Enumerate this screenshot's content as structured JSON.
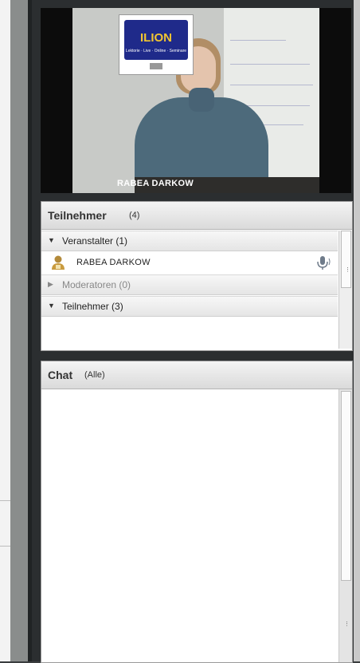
{
  "video": {
    "presenter_name": "RABEA DARKOW",
    "logo": {
      "title": "ILION",
      "subtitle": "Lektorie · Live · Online · Seminare"
    }
  },
  "participants_pod": {
    "title": "Teilnehmer",
    "count": "(4)",
    "groups": [
      {
        "label": "Veranstalter (1)",
        "expanded": true
      },
      {
        "label": "Moderatoren (0)",
        "expanded": false
      },
      {
        "label": "Teilnehmer (3)",
        "expanded": true
      }
    ],
    "hosts": [
      {
        "name": "RABEA DARKOW",
        "role_icon": "host-user-icon",
        "status_icon": "microphone-icon"
      }
    ]
  },
  "chat_pod": {
    "title": "Chat",
    "scope": "(Alle)"
  },
  "colors": {
    "background": "#2b2e30",
    "pod_header": "#e6e6e6",
    "name_caption": "#ffffff"
  }
}
